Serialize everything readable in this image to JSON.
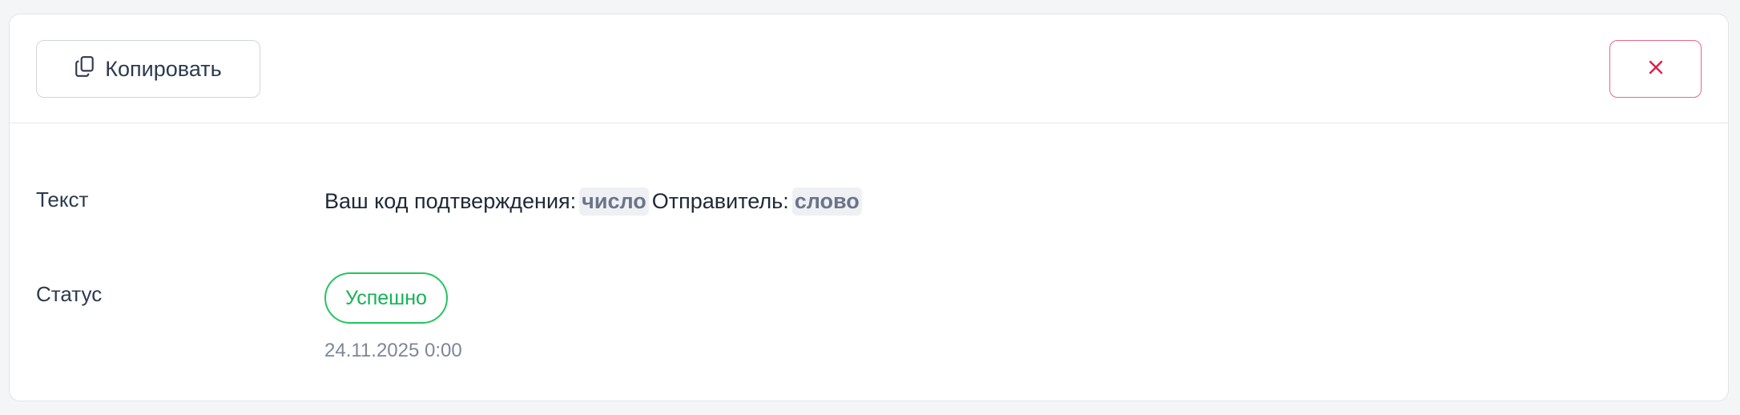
{
  "toolbar": {
    "copy_label": "Копировать",
    "copy_icon": "copy-icon",
    "close_icon": "close-icon"
  },
  "fields": {
    "text_label": "Текст",
    "text_value": {
      "part1": "Ваш код подтверждения:",
      "token1": "число",
      "part2": "Отправитель:",
      "token2": "слово"
    },
    "status_label": "Статус",
    "status_value": "Успешно",
    "timestamp": "24.11.2025 0:00"
  },
  "colors": {
    "success": "#22c55e",
    "danger": "#e11d48",
    "chip_bg": "#eef0f4"
  }
}
